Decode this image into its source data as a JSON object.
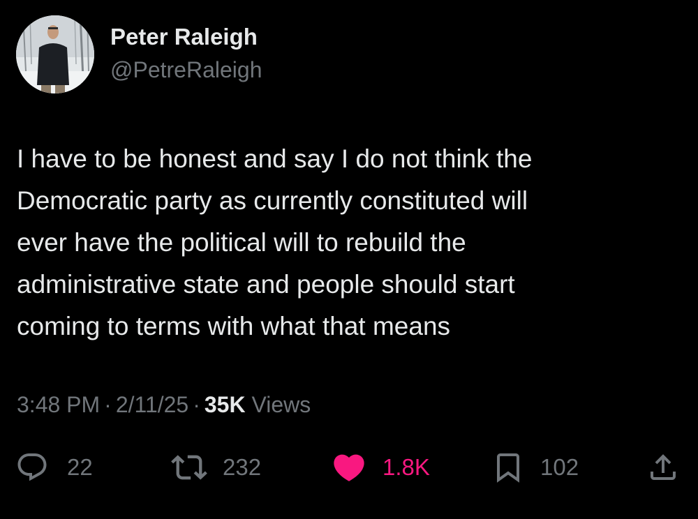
{
  "author": {
    "display_name": "Peter Raleigh",
    "handle": "@PetreRaleigh",
    "avatar_icon": "profile-photo"
  },
  "tweet": {
    "text": "I have to be honest and say I do not think the\nDemocratic party as currently constituted will\never have the political will to rebuild the\nadministrative state and people should start\ncoming to terms with what that means"
  },
  "meta": {
    "time": "3:48 PM",
    "separator": "·",
    "date": "2/11/25",
    "views_count": "35K",
    "views_label": "Views"
  },
  "actions": {
    "reply": {
      "icon": "reply-icon",
      "count": "22"
    },
    "retweet": {
      "icon": "retweet-icon",
      "count": "232"
    },
    "like": {
      "icon": "heart-icon",
      "count": "1.8K",
      "color": "#f91880",
      "liked": true
    },
    "bookmark": {
      "icon": "bookmark-icon",
      "count": "102"
    },
    "share": {
      "icon": "share-icon"
    }
  },
  "colors": {
    "background": "#000000",
    "primary_text": "#e7e9ea",
    "secondary_text": "#71767b",
    "like_pink": "#f91880"
  }
}
